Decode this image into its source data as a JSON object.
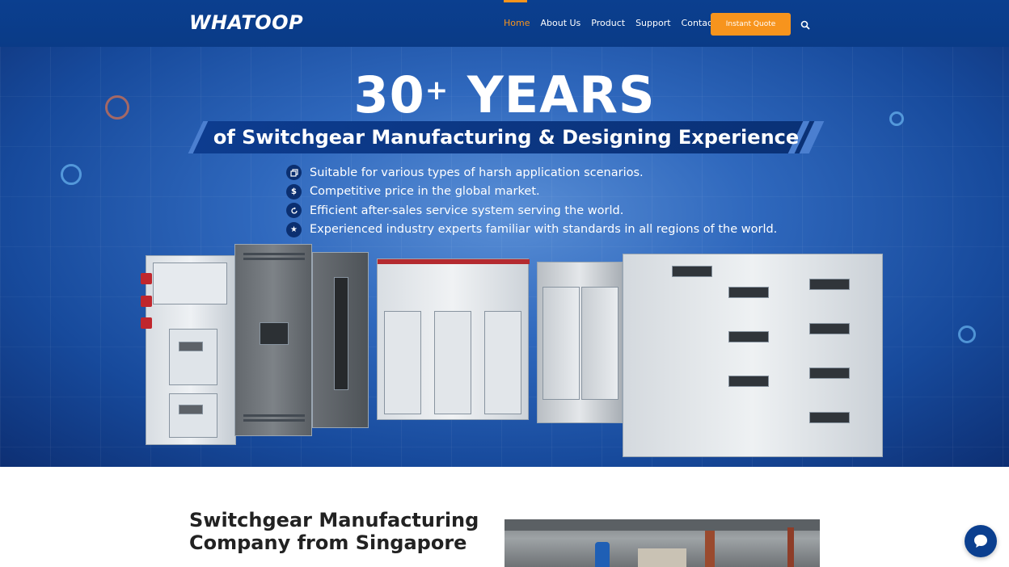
{
  "brand": {
    "logo_text": "WHATOOP"
  },
  "nav": {
    "items": [
      {
        "label": "Home",
        "active": true
      },
      {
        "label": "About Us",
        "active": false
      },
      {
        "label": "Product",
        "active": false
      },
      {
        "label": "Support",
        "active": false
      },
      {
        "label": "Contact",
        "active": false
      }
    ],
    "cta_label": "Instant Quote",
    "search_icon": "search-icon"
  },
  "hero": {
    "headline_number": "30",
    "headline_plus": "+",
    "headline_word": "YEARS",
    "subheadline": "of Switchgear Manufacturing & Designing Experience",
    "features": [
      {
        "icon": "copy-icon",
        "text": "Suitable for various types of harsh application scenarios."
      },
      {
        "icon": "dollar-icon",
        "text": "Competitive price in the global market."
      },
      {
        "icon": "refresh-icon",
        "text": "Efficient after-sales service system serving the world."
      },
      {
        "icon": "star-icon",
        "text": "Experienced industry experts familiar with standards in all regions of the world."
      }
    ]
  },
  "about": {
    "title": "Switchgear Manufacturing Company from Singapore"
  },
  "chat": {
    "icon": "chat-bubble-icon"
  },
  "colors": {
    "navy": "#0b3f8f",
    "accent": "#f7941d"
  }
}
